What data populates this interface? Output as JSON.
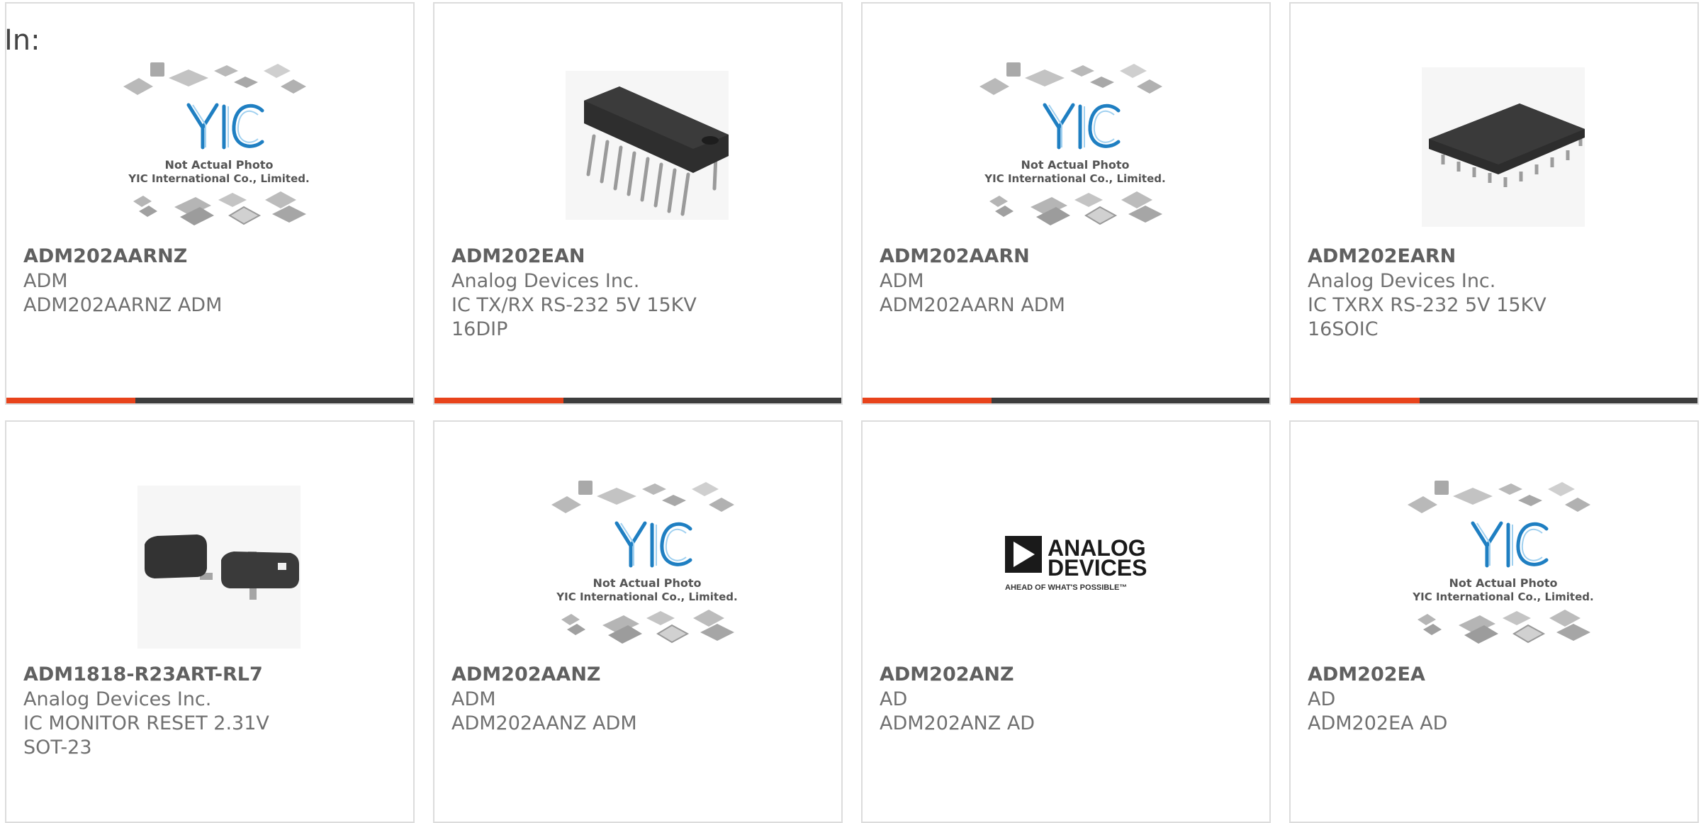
{
  "header": {
    "label": "In:"
  },
  "colors": {
    "accent": "#e8431b",
    "bar": "#3d3d3d",
    "border": "#dcdcdc",
    "yic_blue": "#1f7fc2"
  },
  "placeholder": {
    "logo": "YIC",
    "line1": "Not Actual Photo",
    "line2": "YIC International Co., Limited."
  },
  "adi_logo": {
    "line1": "ANALOG",
    "line2": "DEVICES",
    "tagline": "AHEAD OF WHAT'S POSSIBLE™"
  },
  "products": [
    {
      "part": "ADM202AARNZ",
      "manufacturer": "ADM",
      "description": "ADM202AARNZ ADM",
      "image": "yic-placeholder-icon",
      "has_bar": true
    },
    {
      "part": "ADM202EAN",
      "manufacturer": "Analog Devices Inc.",
      "description": "IC TX/RX RS-232 5V 15KV 16DIP",
      "image": "dip16-chip-icon",
      "has_bar": true
    },
    {
      "part": "ADM202AARN",
      "manufacturer": "ADM",
      "description": "ADM202AARN ADM",
      "image": "yic-placeholder-icon",
      "has_bar": true
    },
    {
      "part": "ADM202EARN",
      "manufacturer": "Analog Devices Inc.",
      "description": "IC TXRX RS-232 5V 15KV 16SOIC",
      "image": "soic16-chip-icon",
      "has_bar": true
    },
    {
      "part": "ADM1818-R23ART-RL7",
      "manufacturer": "Analog Devices Inc.",
      "description": "IC MONITOR RESET 2.31V SOT-23",
      "image": "sot23-chip-icon",
      "has_bar": false
    },
    {
      "part": "ADM202AANZ",
      "manufacturer": "ADM",
      "description": "ADM202AANZ ADM",
      "image": "yic-placeholder-icon",
      "has_bar": false
    },
    {
      "part": "ADM202ANZ",
      "manufacturer": "AD",
      "description": "ADM202ANZ AD",
      "image": "analog-devices-logo",
      "has_bar": false
    },
    {
      "part": "ADM202EA",
      "manufacturer": "AD",
      "description": "ADM202EA AD",
      "image": "yic-placeholder-icon",
      "has_bar": false
    }
  ]
}
